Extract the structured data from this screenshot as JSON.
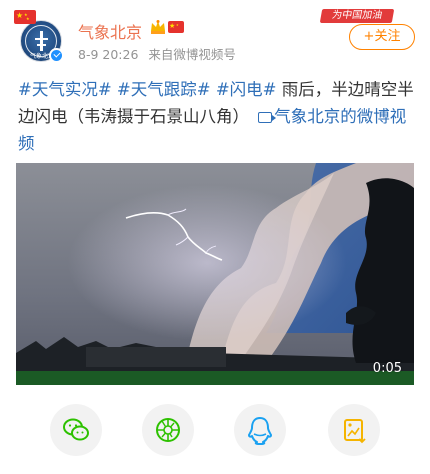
{
  "header": {
    "name": "气象北京",
    "time": "8-9 20:26",
    "source": "来自微博视频号",
    "slogan": "为中国加油",
    "follow_label": "+关注",
    "avatar_text": "气象北京"
  },
  "post": {
    "topics": [
      "#天气实况#",
      "#天气跟踪#",
      "#闪电#"
    ],
    "text": "雨后，半边晴空半边闪电（韦涛摄于石景山八角）",
    "video_link_text": "气象北京的微博视频"
  },
  "video": {
    "duration": "0:05"
  },
  "share": {
    "icons": [
      "wechat-icon",
      "moments-icon",
      "qq-icon",
      "qzone-icon"
    ]
  },
  "colors": {
    "name_orange": "#eb7350",
    "topic_blue": "#2f6fb8",
    "follow_orange": "#ff8200",
    "wechat_green": "#2dc100",
    "qq_blue": "#1aa1f1",
    "qzone_yellow": "#f5b400"
  }
}
